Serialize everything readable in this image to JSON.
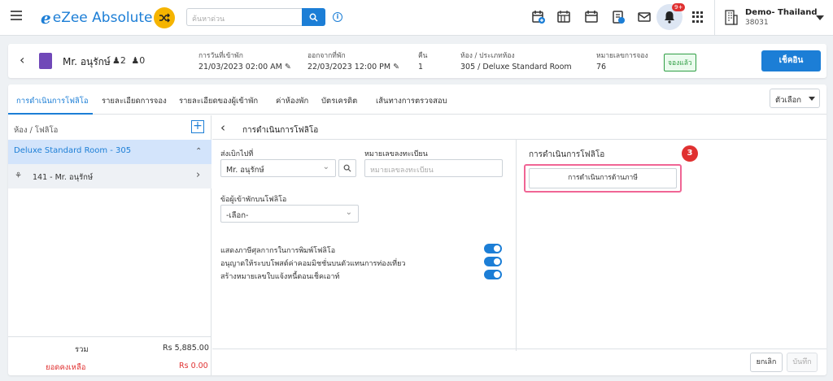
{
  "topbar": {
    "logo": "eZee Absolute",
    "search_placeholder": "ค้นหาด่วน",
    "notification_count": "9+",
    "property_name": "Demo- Thailand",
    "property_code": "38031"
  },
  "reservation": {
    "guest_name": "Mr. อนุรักษ์",
    "adults": "2",
    "children": "0",
    "arrival_label": "การวันที่เข้าพัก",
    "arrival_value": "21/03/2023 02:00 AM",
    "departure_label": "ออกจากที่พัก",
    "departure_value": "22/03/2023 12:00 PM",
    "nights_label": "คืน",
    "nights_value": "1",
    "room_label": "ห้อง / ประเภทห้อง",
    "room_value": "305 / Deluxe Standard Room",
    "resno_label": "หมายเลขการจอง",
    "resno_value": "76",
    "status": "จองแล้ว",
    "checkin_button": "เช็คอิน"
  },
  "tabs": [
    {
      "label": "การดำเนินการโฟลิโอ"
    },
    {
      "label": "รายละเอียดการจอง"
    },
    {
      "label": "รายละเอียดของผู้เข้าพัก"
    },
    {
      "label": "ค่าห้องพัก"
    },
    {
      "label": "บัตรเครดิต"
    },
    {
      "label": "เส้นทางการตรวจสอบ"
    }
  ],
  "options_button": "ตัวเลือก",
  "folio_list": {
    "title": "ห้อง / โฟลิโอ",
    "room": "Deluxe Standard Room - 305",
    "folio": "141 - Mr. อนุรักษ์",
    "total_label": "รวม",
    "total_value": "Rs 5,885.00",
    "balance_label": "ยอดคงเหลือ",
    "balance_value": "Rs 0.00"
  },
  "content": {
    "title": "การดำเนินการโฟลิโอ",
    "send_to_label": "ส่งเบิกไปที่",
    "send_to_value": "Mr. อนุรักษ์",
    "reg_label": "หมายเลขลงทะเบียน",
    "reg_placeholder": "หมายเลขลงทะเบียน",
    "guest_folio_label": "ข้อผู้เข้าพักบนโฟลิโอ",
    "guest_folio_value": "-เลือก-",
    "toggles": [
      {
        "label": "แสดงภาษีศุลกากรในการพิมพ์โฟลิโอ",
        "on": true
      },
      {
        "label": "อนุญาตให้ระบบโพสต์ค่าคอมมิชชั่นบนตัวแทนการท่องเที่ยว",
        "on": true
      },
      {
        "label": "สร้างหมายเลขใบแจ้งหนี้ตอนเช็คเอาท์",
        "on": true
      }
    ],
    "op_title": "การดำเนินการโฟลิโอ",
    "op_button": "การดำเนินการด้านภาษี",
    "step_number": "3",
    "cancel": "ยกเลิก",
    "save": "บันทึก"
  }
}
